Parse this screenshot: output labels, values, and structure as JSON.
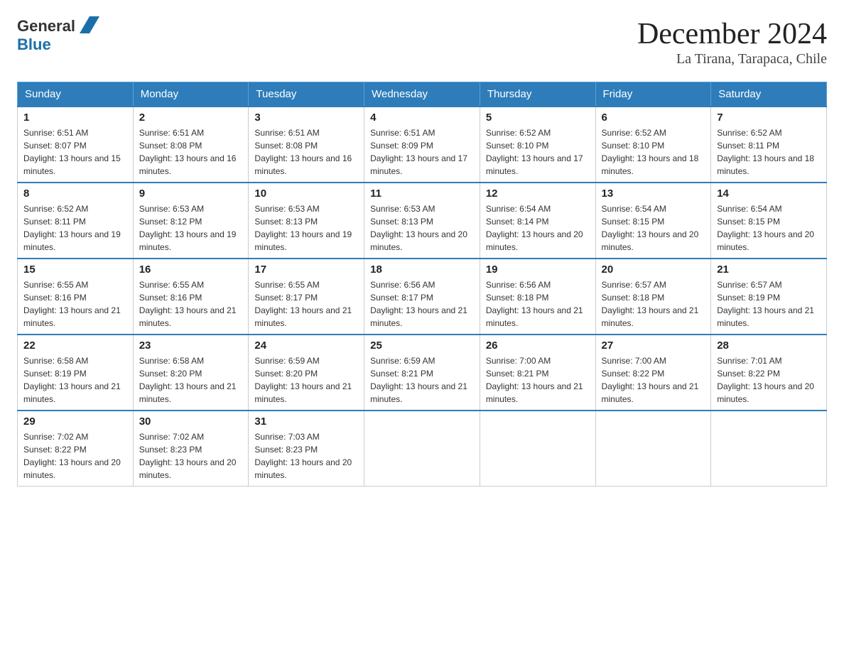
{
  "header": {
    "logo_text_general": "General",
    "logo_text_blue": "Blue",
    "title": "December 2024",
    "subtitle": "La Tirana, Tarapaca, Chile"
  },
  "calendar": {
    "days_of_week": [
      "Sunday",
      "Monday",
      "Tuesday",
      "Wednesday",
      "Thursday",
      "Friday",
      "Saturday"
    ],
    "weeks": [
      [
        {
          "day": "1",
          "sunrise": "6:51 AM",
          "sunset": "8:07 PM",
          "daylight": "13 hours and 15 minutes."
        },
        {
          "day": "2",
          "sunrise": "6:51 AM",
          "sunset": "8:08 PM",
          "daylight": "13 hours and 16 minutes."
        },
        {
          "day": "3",
          "sunrise": "6:51 AM",
          "sunset": "8:08 PM",
          "daylight": "13 hours and 16 minutes."
        },
        {
          "day": "4",
          "sunrise": "6:51 AM",
          "sunset": "8:09 PM",
          "daylight": "13 hours and 17 minutes."
        },
        {
          "day": "5",
          "sunrise": "6:52 AM",
          "sunset": "8:10 PM",
          "daylight": "13 hours and 17 minutes."
        },
        {
          "day": "6",
          "sunrise": "6:52 AM",
          "sunset": "8:10 PM",
          "daylight": "13 hours and 18 minutes."
        },
        {
          "day": "7",
          "sunrise": "6:52 AM",
          "sunset": "8:11 PM",
          "daylight": "13 hours and 18 minutes."
        }
      ],
      [
        {
          "day": "8",
          "sunrise": "6:52 AM",
          "sunset": "8:11 PM",
          "daylight": "13 hours and 19 minutes."
        },
        {
          "day": "9",
          "sunrise": "6:53 AM",
          "sunset": "8:12 PM",
          "daylight": "13 hours and 19 minutes."
        },
        {
          "day": "10",
          "sunrise": "6:53 AM",
          "sunset": "8:13 PM",
          "daylight": "13 hours and 19 minutes."
        },
        {
          "day": "11",
          "sunrise": "6:53 AM",
          "sunset": "8:13 PM",
          "daylight": "13 hours and 20 minutes."
        },
        {
          "day": "12",
          "sunrise": "6:54 AM",
          "sunset": "8:14 PM",
          "daylight": "13 hours and 20 minutes."
        },
        {
          "day": "13",
          "sunrise": "6:54 AM",
          "sunset": "8:15 PM",
          "daylight": "13 hours and 20 minutes."
        },
        {
          "day": "14",
          "sunrise": "6:54 AM",
          "sunset": "8:15 PM",
          "daylight": "13 hours and 20 minutes."
        }
      ],
      [
        {
          "day": "15",
          "sunrise": "6:55 AM",
          "sunset": "8:16 PM",
          "daylight": "13 hours and 21 minutes."
        },
        {
          "day": "16",
          "sunrise": "6:55 AM",
          "sunset": "8:16 PM",
          "daylight": "13 hours and 21 minutes."
        },
        {
          "day": "17",
          "sunrise": "6:55 AM",
          "sunset": "8:17 PM",
          "daylight": "13 hours and 21 minutes."
        },
        {
          "day": "18",
          "sunrise": "6:56 AM",
          "sunset": "8:17 PM",
          "daylight": "13 hours and 21 minutes."
        },
        {
          "day": "19",
          "sunrise": "6:56 AM",
          "sunset": "8:18 PM",
          "daylight": "13 hours and 21 minutes."
        },
        {
          "day": "20",
          "sunrise": "6:57 AM",
          "sunset": "8:18 PM",
          "daylight": "13 hours and 21 minutes."
        },
        {
          "day": "21",
          "sunrise": "6:57 AM",
          "sunset": "8:19 PM",
          "daylight": "13 hours and 21 minutes."
        }
      ],
      [
        {
          "day": "22",
          "sunrise": "6:58 AM",
          "sunset": "8:19 PM",
          "daylight": "13 hours and 21 minutes."
        },
        {
          "day": "23",
          "sunrise": "6:58 AM",
          "sunset": "8:20 PM",
          "daylight": "13 hours and 21 minutes."
        },
        {
          "day": "24",
          "sunrise": "6:59 AM",
          "sunset": "8:20 PM",
          "daylight": "13 hours and 21 minutes."
        },
        {
          "day": "25",
          "sunrise": "6:59 AM",
          "sunset": "8:21 PM",
          "daylight": "13 hours and 21 minutes."
        },
        {
          "day": "26",
          "sunrise": "7:00 AM",
          "sunset": "8:21 PM",
          "daylight": "13 hours and 21 minutes."
        },
        {
          "day": "27",
          "sunrise": "7:00 AM",
          "sunset": "8:22 PM",
          "daylight": "13 hours and 21 minutes."
        },
        {
          "day": "28",
          "sunrise": "7:01 AM",
          "sunset": "8:22 PM",
          "daylight": "13 hours and 20 minutes."
        }
      ],
      [
        {
          "day": "29",
          "sunrise": "7:02 AM",
          "sunset": "8:22 PM",
          "daylight": "13 hours and 20 minutes."
        },
        {
          "day": "30",
          "sunrise": "7:02 AM",
          "sunset": "8:23 PM",
          "daylight": "13 hours and 20 minutes."
        },
        {
          "day": "31",
          "sunrise": "7:03 AM",
          "sunset": "8:23 PM",
          "daylight": "13 hours and 20 minutes."
        },
        null,
        null,
        null,
        null
      ]
    ]
  }
}
